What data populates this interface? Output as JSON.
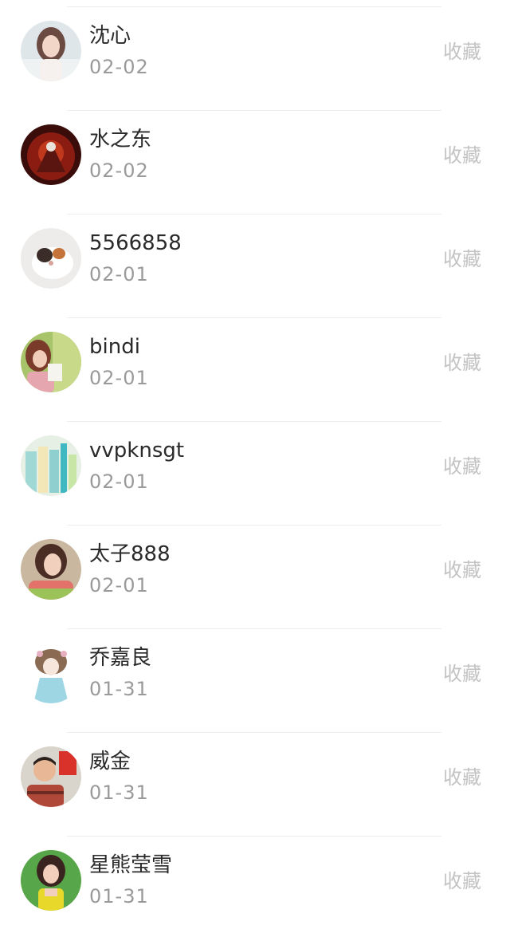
{
  "users": [
    {
      "name": "沈心",
      "date": "02-02",
      "action": "收藏"
    },
    {
      "name": "水之东",
      "date": "02-02",
      "action": "收藏"
    },
    {
      "name": "5566858",
      "date": "02-01",
      "action": "收藏"
    },
    {
      "name": "bindi",
      "date": "02-01",
      "action": "收藏"
    },
    {
      "name": "vvpknsgt",
      "date": "02-01",
      "action": "收藏"
    },
    {
      "name": "太子888",
      "date": "02-01",
      "action": "收藏"
    },
    {
      "name": "乔嘉良",
      "date": "01-31",
      "action": "收藏"
    },
    {
      "name": "威金",
      "date": "01-31",
      "action": "收藏"
    },
    {
      "name": "星熊莹雪",
      "date": "01-31",
      "action": "收藏"
    }
  ]
}
